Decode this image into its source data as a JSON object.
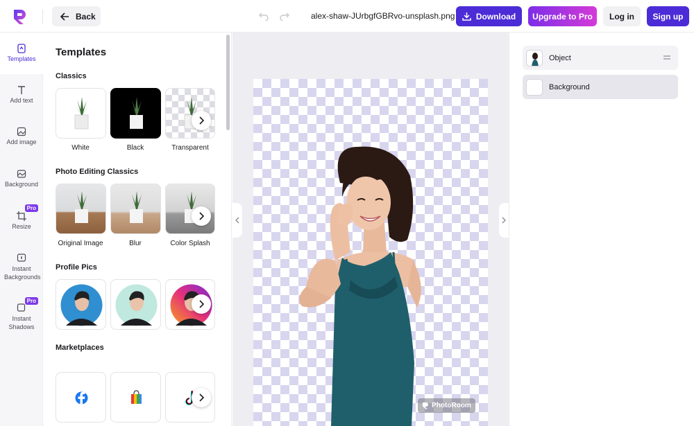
{
  "topbar": {
    "back_label": "Back",
    "filename": "alex-shaw-JUrbgfGBRvo-unsplash.png",
    "download_label": "Download",
    "upgrade_label": "Upgrade to Pro",
    "login_label": "Log in",
    "signup_label": "Sign up"
  },
  "colors": {
    "accent": "#4b2cd6",
    "pro_gradient_start": "#7c2ee8",
    "pro_gradient_end": "#d43ad6",
    "checker_purple": "#d8d5ee",
    "dress": "#1f5f6b"
  },
  "rail": {
    "items": [
      {
        "label": "Templates",
        "icon": "templates-icon",
        "active": true
      },
      {
        "label": "Add text",
        "icon": "text-icon"
      },
      {
        "label": "Add image",
        "icon": "image-icon"
      },
      {
        "label": "Background",
        "icon": "background-icon"
      },
      {
        "label": "Resize",
        "icon": "crop-icon",
        "badge": "Pro"
      },
      {
        "label": "Instant Backgrounds",
        "icon": "sparkle-icon"
      },
      {
        "label": "Instant Shadows",
        "icon": "shadow-icon",
        "badge": "Pro"
      }
    ]
  },
  "panel": {
    "title": "Templates",
    "sections": [
      {
        "title": "Classics",
        "items": [
          "White",
          "Black",
          "Transparent"
        ]
      },
      {
        "title": "Photo Editing Classics",
        "items": [
          "Original Image",
          "Blur",
          "Color Splash"
        ]
      },
      {
        "title": "Profile Pics",
        "items": []
      },
      {
        "title": "Marketplaces",
        "items": []
      }
    ]
  },
  "canvas": {
    "watermark": "PhotoRoom"
  },
  "layers": {
    "items": [
      {
        "label": "Object"
      },
      {
        "label": "Background"
      }
    ]
  }
}
